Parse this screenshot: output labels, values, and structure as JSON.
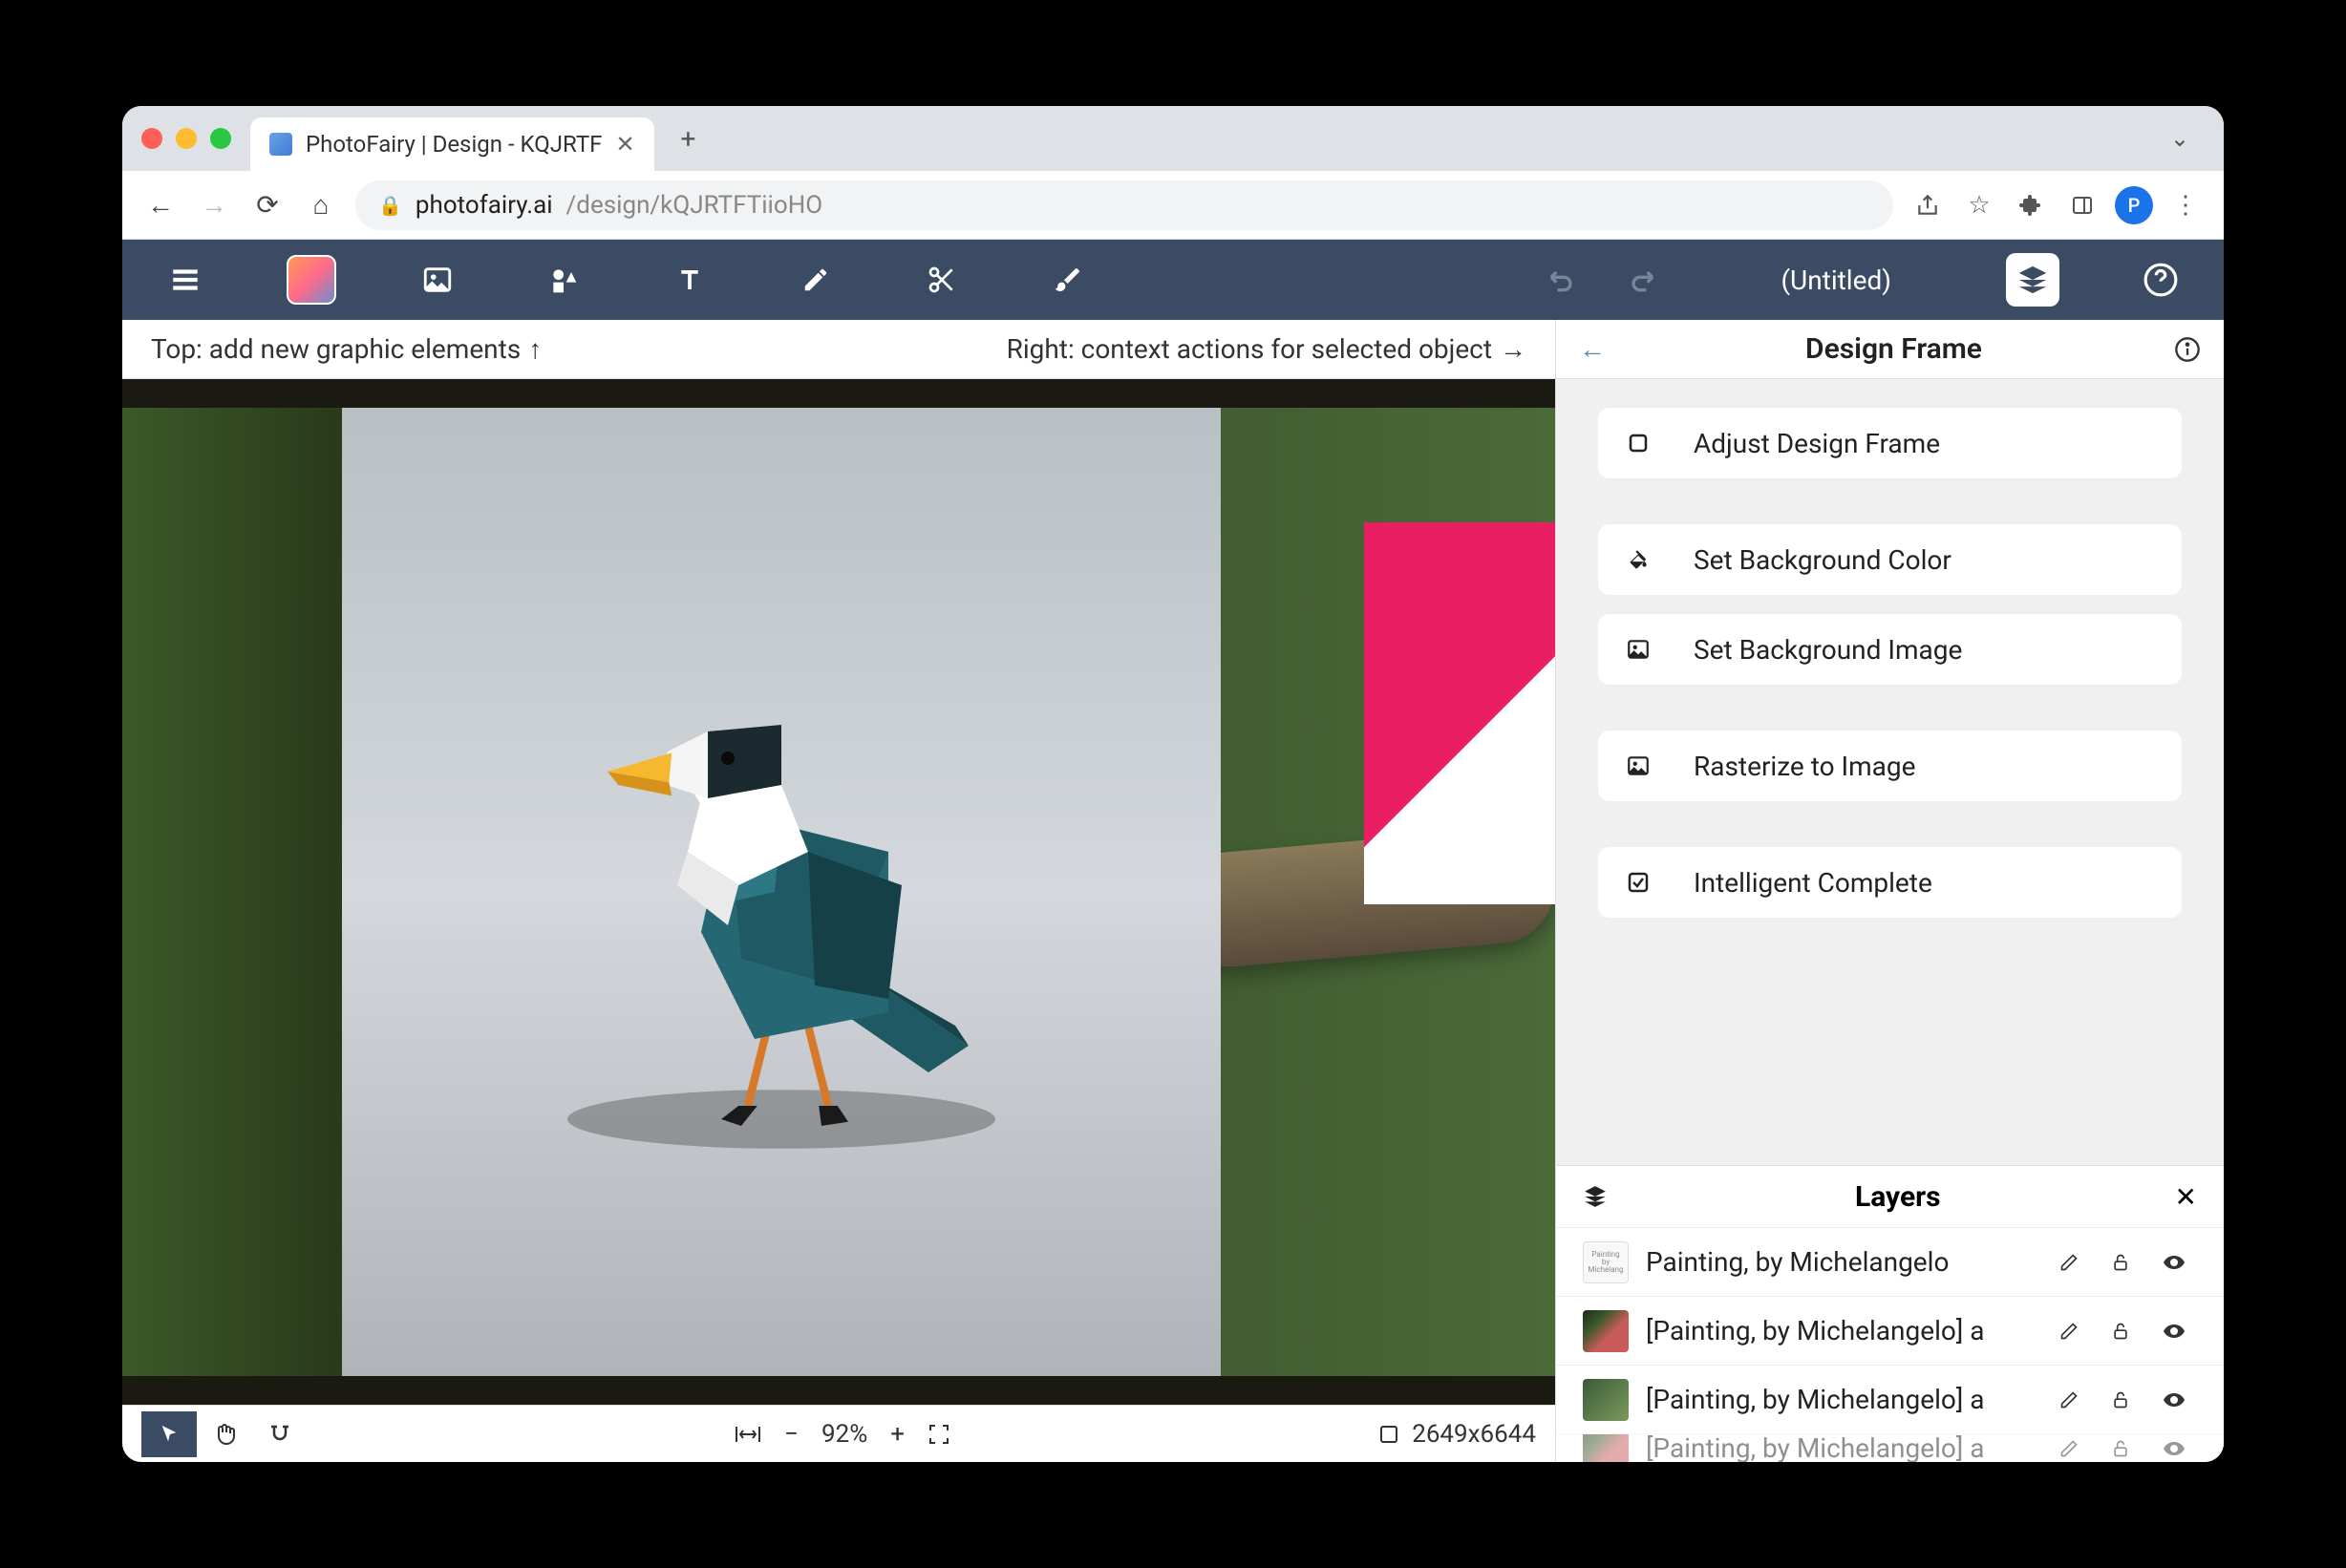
{
  "tab": {
    "title": "PhotoFairy | Design - KQJRTF"
  },
  "url": {
    "host": "photofairy.ai",
    "path": "/design/kQJRTFTiioHO"
  },
  "profile": {
    "initial": "P"
  },
  "app": {
    "title": "(Untitled)"
  },
  "hints": {
    "left": "Top: add new graphic elements",
    "right": "Right: context actions for selected object"
  },
  "zoom": {
    "value": "92%"
  },
  "dimensions": {
    "value": "2649x6644"
  },
  "panel": {
    "title": "Design Frame",
    "actions": {
      "adjust": "Adjust Design Frame",
      "bgcolor": "Set Background Color",
      "bgimage": "Set Background Image",
      "rasterize": "Rasterize to Image",
      "intelligent": "Intelligent Complete"
    }
  },
  "layers": {
    "title": "Layers",
    "items": [
      {
        "name": "Painting, by Michelangelo"
      },
      {
        "name": "[Painting, by Michelangelo] a"
      },
      {
        "name": "[Painting, by Michelangelo] a"
      },
      {
        "name": "[Painting, by Michelangelo] a"
      }
    ]
  }
}
